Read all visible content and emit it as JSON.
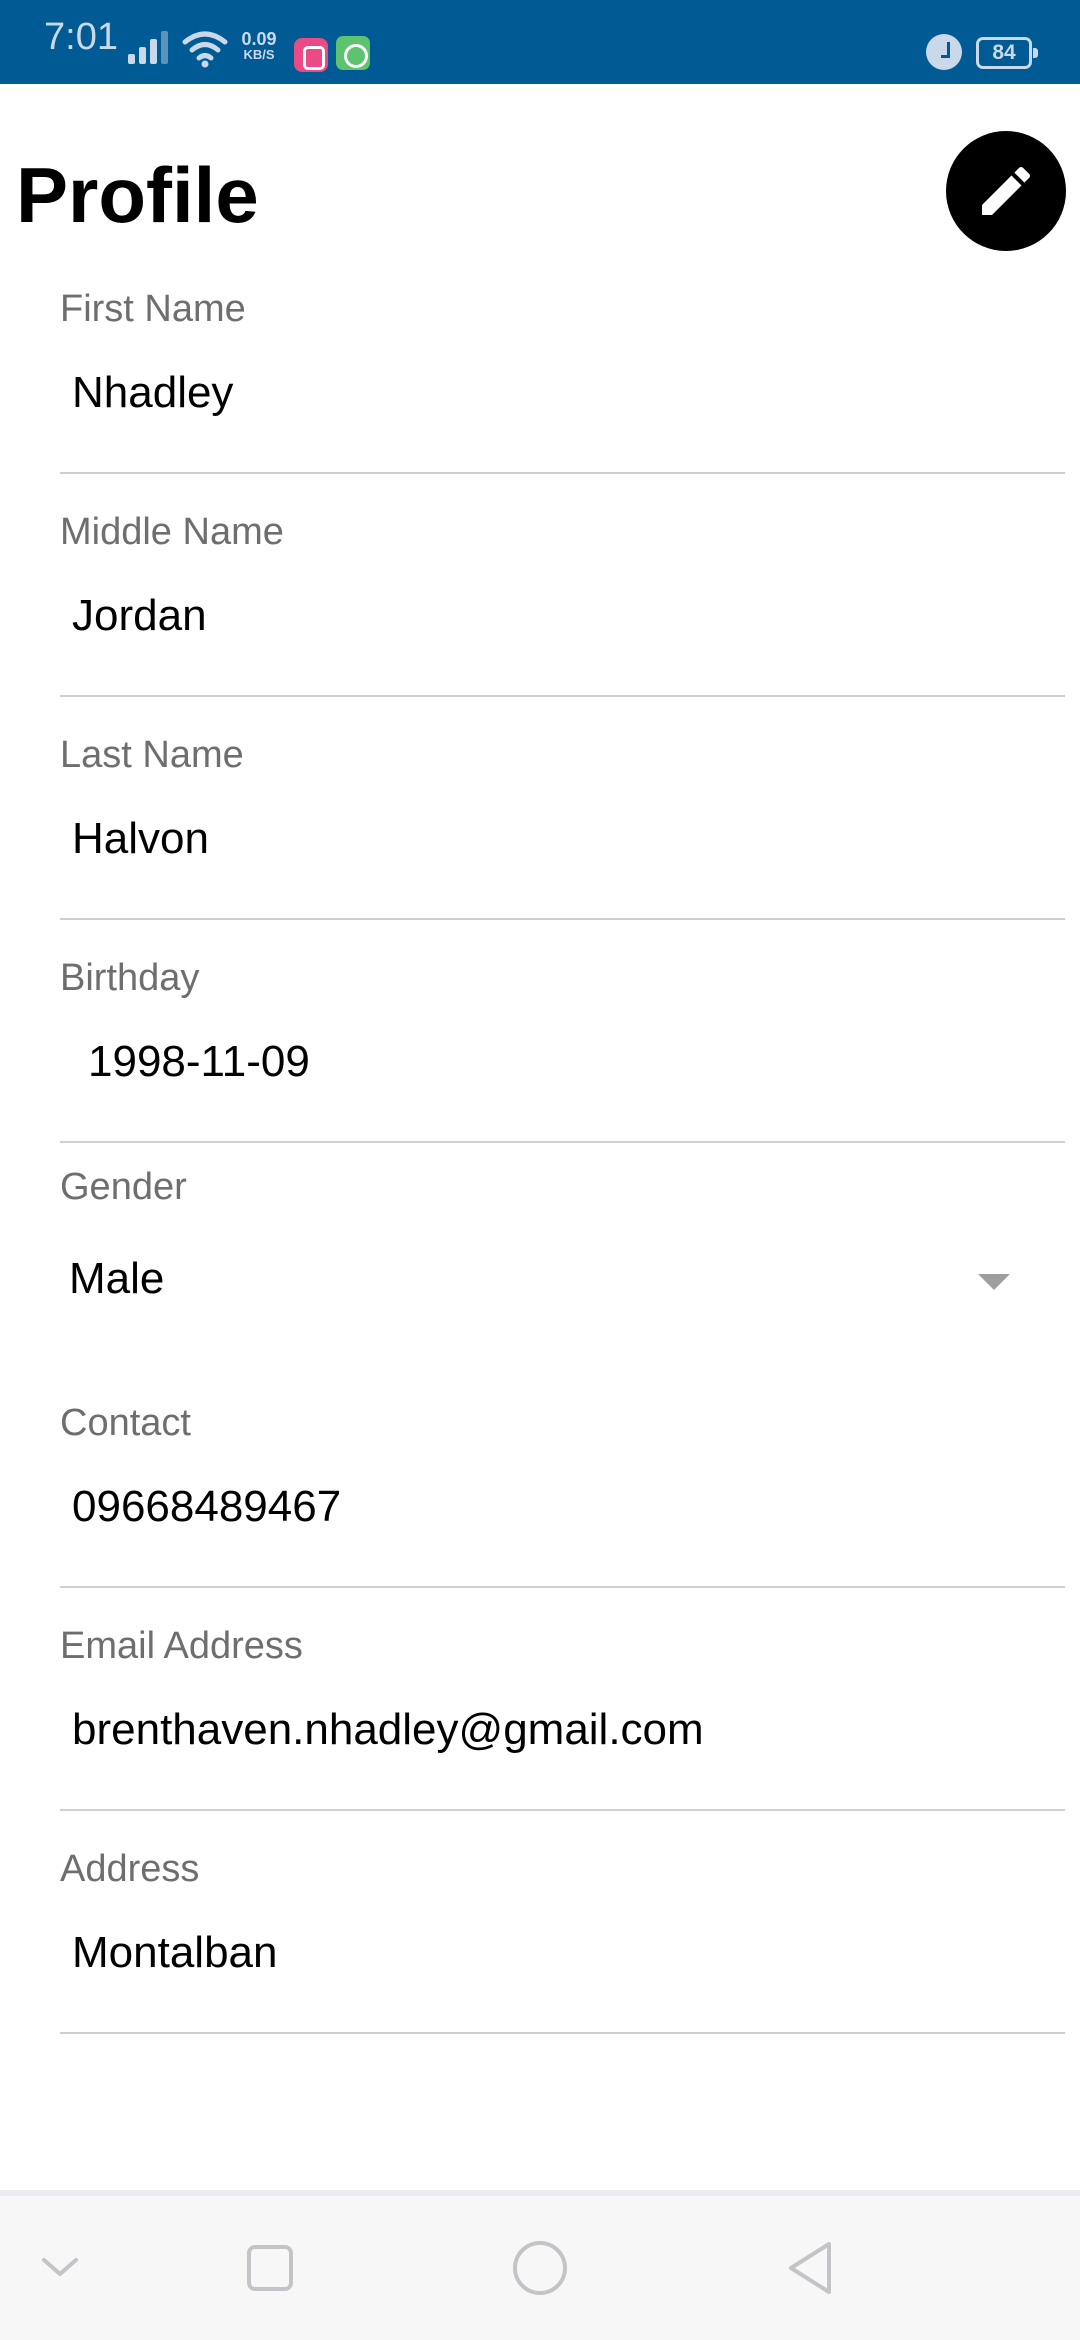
{
  "status_bar": {
    "time": "7:01",
    "network_speed": "0.09",
    "network_speed_unit": "KB/S",
    "battery": "84",
    "background_color": "#005a93",
    "icons": [
      "signal-icon",
      "wifi-icon",
      "app-notification-icon",
      "app-notification-icon",
      "alarm-icon",
      "battery-icon"
    ]
  },
  "header": {
    "title": "Profile",
    "edit_icon": "pencil-icon"
  },
  "fields": {
    "first_name": {
      "label": "First Name",
      "value": "Nhadley"
    },
    "middle_name": {
      "label": "Middle Name",
      "value": "Jordan"
    },
    "last_name": {
      "label": "Last Name",
      "value": "Halvon"
    },
    "birthday": {
      "label": "Birthday",
      "value": "1998-11-09"
    },
    "gender": {
      "label": "Gender",
      "value": "Male"
    },
    "contact": {
      "label": "Contact",
      "value": "09668489467"
    },
    "email": {
      "label": "Email Address",
      "value": "brenthaven.nhadley@gmail.com"
    },
    "address": {
      "label": "Address",
      "value": "Montalban"
    }
  },
  "nav_bar": {
    "icons": [
      "chevron-down-icon",
      "square-icon",
      "circle-icon",
      "triangle-back-icon"
    ]
  }
}
